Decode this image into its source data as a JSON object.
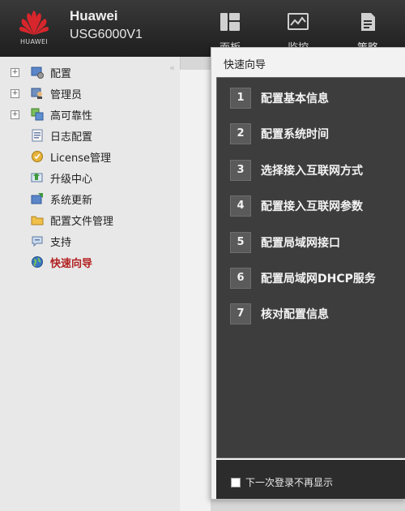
{
  "header": {
    "logo_text": "HUAWEI",
    "brand": "Huawei",
    "model": "USG6000V1",
    "nav": [
      {
        "label": "面板",
        "icon": "dashboard-icon"
      },
      {
        "label": "监控",
        "icon": "monitor-icon"
      },
      {
        "label": "策略",
        "icon": "policy-icon"
      }
    ]
  },
  "sidebar": {
    "items": [
      {
        "label": "配置",
        "icon": "config-icon",
        "expandable": true
      },
      {
        "label": "管理员",
        "icon": "admin-icon",
        "expandable": true
      },
      {
        "label": "高可靠性",
        "icon": "ha-icon",
        "expandable": true
      },
      {
        "label": "日志配置",
        "icon": "log-icon",
        "expandable": false
      },
      {
        "label": "License管理",
        "icon": "license-icon",
        "expandable": false
      },
      {
        "label": "升级中心",
        "icon": "upgrade-icon",
        "expandable": false
      },
      {
        "label": "系统更新",
        "icon": "update-icon",
        "expandable": false
      },
      {
        "label": "配置文件管理",
        "icon": "folder-icon",
        "expandable": false
      },
      {
        "label": "支持",
        "icon": "support-icon",
        "expandable": false
      },
      {
        "label": "快速向导",
        "icon": "globe-icon",
        "expandable": false,
        "active": true
      }
    ]
  },
  "dialog": {
    "title": "快速向导",
    "steps": [
      {
        "num": "1",
        "label": "配置基本信息"
      },
      {
        "num": "2",
        "label": "配置系统时间"
      },
      {
        "num": "3",
        "label": "选择接入互联网方式"
      },
      {
        "num": "4",
        "label": "配置接入互联网参数"
      },
      {
        "num": "5",
        "label": "配置局域网接口"
      },
      {
        "num": "6",
        "label": "配置局域网DHCP服务"
      },
      {
        "num": "7",
        "label": "核对配置信息"
      }
    ],
    "dont_show_label": "下一次登录不再显示"
  },
  "colors": {
    "header_bg": "#2a2a2a",
    "active_item": "#b22020",
    "steps_panel_bg": "#3d3d3d",
    "step_number_bg": "#5a5a5a",
    "logo_red": "#d7262c"
  }
}
